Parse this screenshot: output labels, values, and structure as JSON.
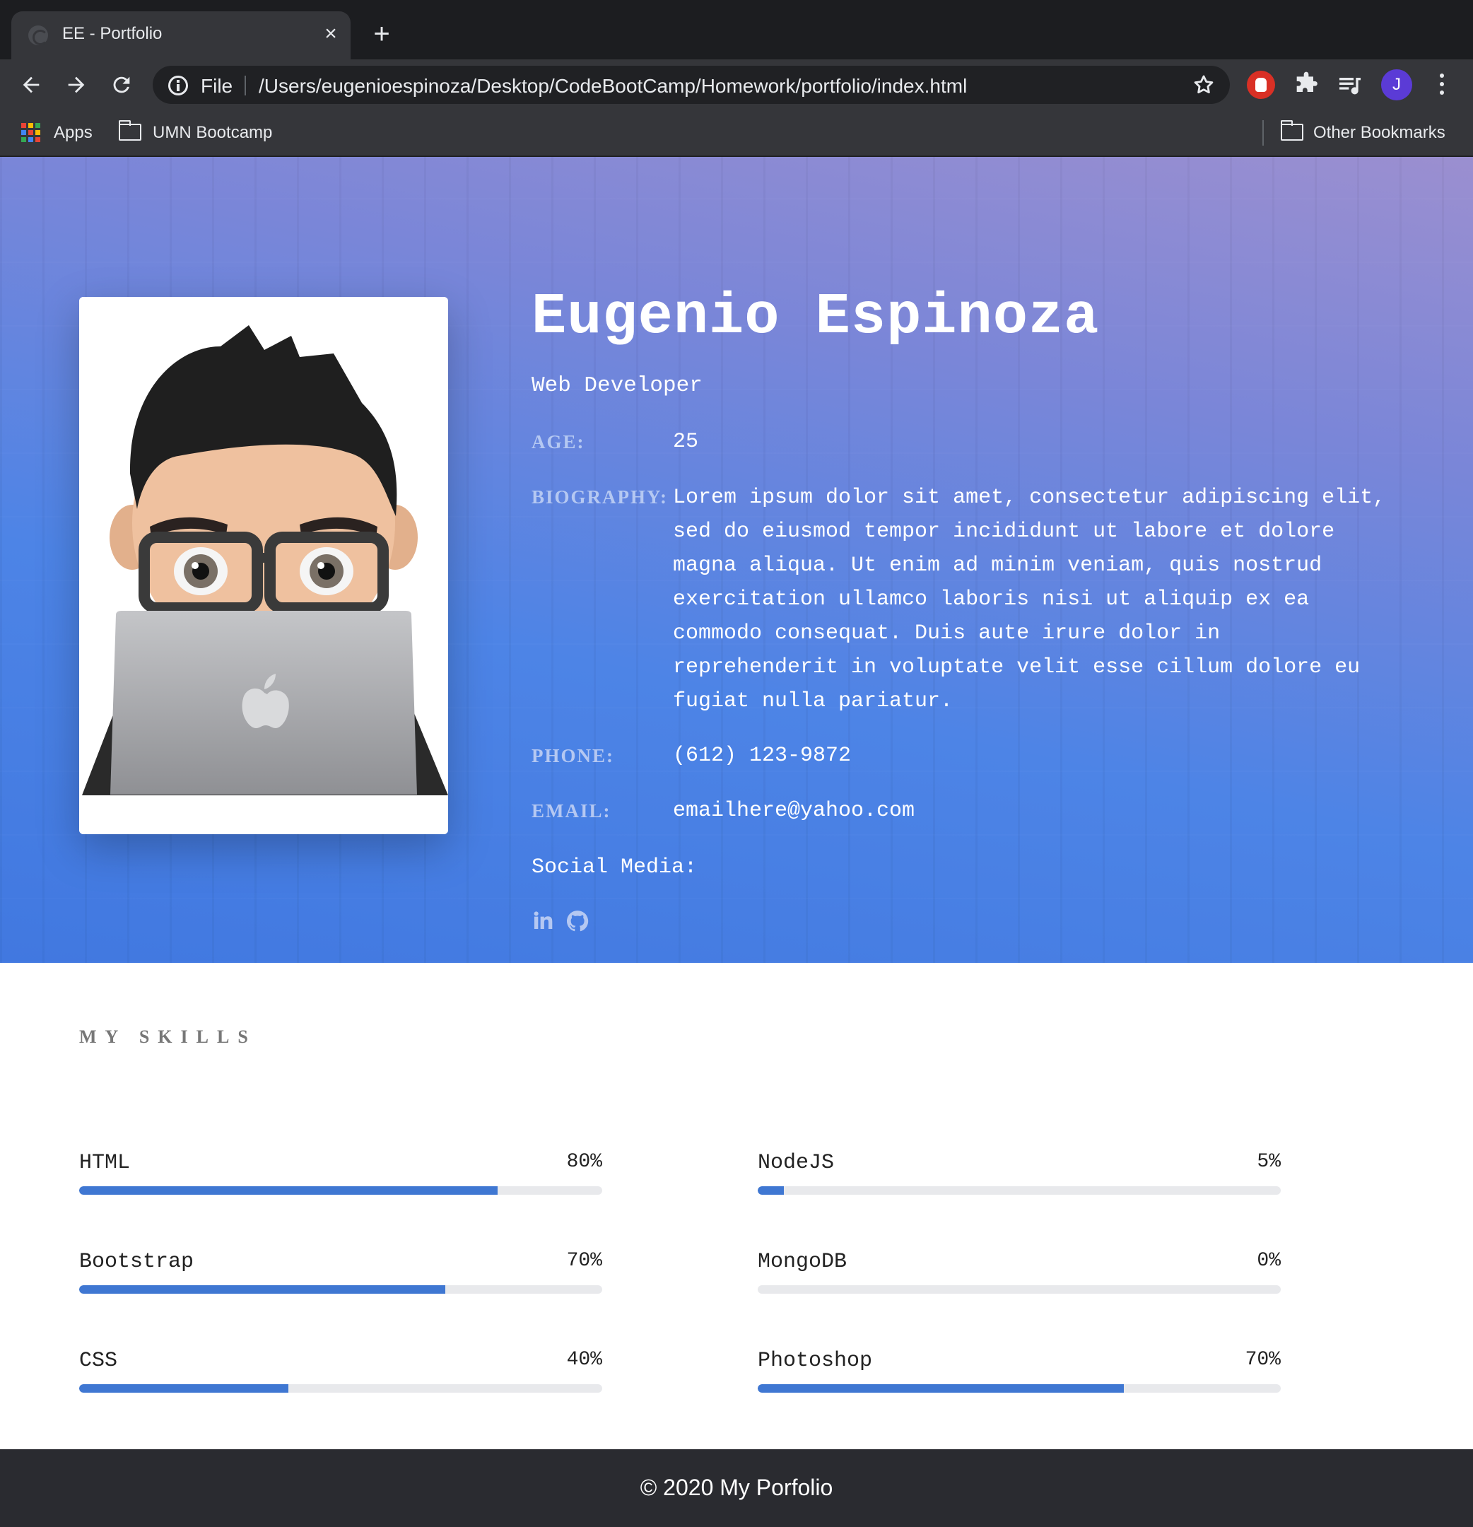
{
  "browser": {
    "tab_title": "EE - Portfolio",
    "tab_close": "×",
    "new_tab": "+",
    "url_scheme": "File",
    "url": "/Users/eugenioespinoza/Desktop/CodeBootCamp/Homework/portfolio/index.html",
    "profile_initial": "J",
    "bookmarks": [
      {
        "label": "Apps",
        "icon": "apps-grid-icon"
      },
      {
        "label": "UMN Bootcamp",
        "icon": "folder-icon"
      }
    ],
    "other_bookmarks": "Other Bookmarks",
    "extension_colors": {
      "red_extension": "#d93025",
      "avatar": "#5b3bd6"
    }
  },
  "profile": {
    "name": "Eugenio Espinoza",
    "role": "Web Developer",
    "age_label": "AGE:",
    "age": "25",
    "bio_label": "BIOGRAPHY:",
    "bio": "Lorem ipsum dolor sit amet, consectetur adipiscing elit, sed do eiusmod tempor incididunt ut labore et dolore magna aliqua. Ut enim ad minim veniam, quis nostrud exercitation ullamco laboris nisi ut aliquip ex ea commodo consequat. Duis aute irure dolor in reprehenderit in voluptate velit esse cillum dolore eu fugiat nulla pariatur.",
    "phone_label": "PHONE:",
    "phone": "(612) 123-9872",
    "email_label": "EMAIL:",
    "email": "emailhere@yahoo.com",
    "social_label": "Social Media:",
    "social_icons": [
      "linkedin-icon",
      "github-icon"
    ]
  },
  "skills": {
    "title": "MY SKILLS",
    "accent_color": "#3f77d2",
    "left": [
      {
        "name": "HTML",
        "percent_label": "80%",
        "value": 0.8
      },
      {
        "name": "Bootstrap",
        "percent_label": "70%",
        "value": 0.7
      },
      {
        "name": "CSS",
        "percent_label": "40%",
        "value": 0.4
      }
    ],
    "right": [
      {
        "name": "NodeJS",
        "percent_label": "5%",
        "value": 0.05
      },
      {
        "name": "MongoDB",
        "percent_label": "0%",
        "value": 0.0
      },
      {
        "name": "Photoshop",
        "percent_label": "70%",
        "value": 0.7
      }
    ]
  },
  "footer": {
    "text": "© 2020 My Porfolio"
  },
  "theme": {
    "hero_gradient": [
      "#4178e0",
      "#9b8fd0"
    ],
    "footer_bg": "#2a2b30"
  }
}
